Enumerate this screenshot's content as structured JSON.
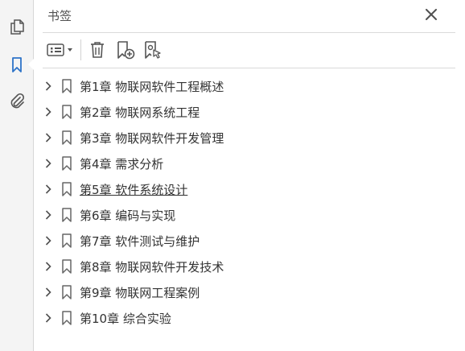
{
  "panel": {
    "title": "书签"
  },
  "toolbar": {
    "buttons": [
      {
        "icon": "bookmark-options-icon"
      },
      {
        "icon": "delete-trash-icon"
      },
      {
        "icon": "new-bookmark-icon"
      },
      {
        "icon": "bookmark-from-selection-icon"
      }
    ]
  },
  "sidebar": {
    "buttons": [
      {
        "icon": "page-thumbnails-icon"
      },
      {
        "icon": "bookmarks-icon",
        "active": true
      },
      {
        "icon": "attachments-paperclip-icon"
      }
    ]
  },
  "bookmarks": [
    {
      "label": "第1章  物联网软件工程概述"
    },
    {
      "label": "第2章  物联网系统工程"
    },
    {
      "label": "第3章  物联网软件开发管理"
    },
    {
      "label": "第4章  需求分析"
    },
    {
      "label": "第5章  软件系统设计",
      "hovered": true
    },
    {
      "label": "第6章  编码与实现"
    },
    {
      "label": "第7章  软件测试与维护"
    },
    {
      "label": "第8章  物联网软件开发技术"
    },
    {
      "label": "第9章  物联网工程案例"
    },
    {
      "label": "第10章  综合实验"
    }
  ],
  "colors": {
    "accent": "#2d73c8",
    "icon": "#555555",
    "rail": "#f4f4f4"
  }
}
